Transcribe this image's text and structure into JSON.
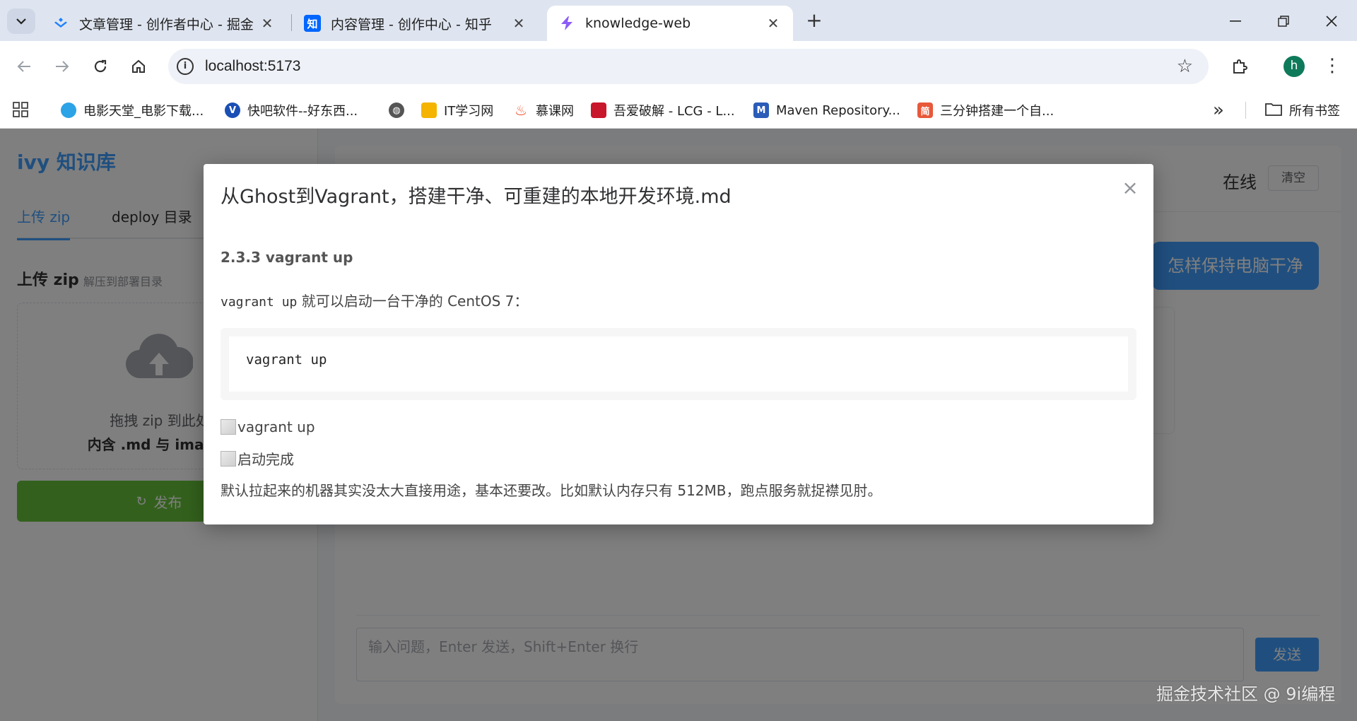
{
  "browser": {
    "tabs": [
      {
        "title": "文章管理 - 创作者中心 - 掘金",
        "favicon": "juejin-icon",
        "active": false
      },
      {
        "title": "内容管理 - 创作中心 - 知乎",
        "favicon": "zhihu-icon",
        "favicon_text": "知",
        "active": false
      },
      {
        "title": "knowledge-web",
        "favicon": "vite-icon",
        "active": true
      }
    ],
    "url": "localhost:5173",
    "profile_initial": "h",
    "bookmarks": [
      {
        "label": "电影天堂_电影下载...",
        "icon": "shield-icon"
      },
      {
        "label": "快吧软件--好东西...",
        "icon": "v-icon"
      },
      {
        "label": "",
        "icon": "globe-icon"
      },
      {
        "label": "IT学习网",
        "icon": "folder-mail-icon"
      },
      {
        "label": "慕课网",
        "icon": "flame-icon"
      },
      {
        "label": "吾爱破解 - LCG - L...",
        "icon": "52pojie-icon"
      },
      {
        "label": "Maven Repository...",
        "icon": "maven-icon",
        "icon_text": "M"
      },
      {
        "label": "三分钟搭建一个自...",
        "icon": "jianshu-icon",
        "icon_text": "简"
      }
    ],
    "all_bookmarks": "所有书签"
  },
  "sidebar": {
    "logo": "ivy 知识库",
    "tabs": [
      "上传 zip",
      "deploy 目录"
    ],
    "upload_title": "上传 zip",
    "upload_sub": "解压到部署目录",
    "drop_line1": "拖拽 zip 到此处",
    "drop_line2": "内含 .md 与 images",
    "publish": "发布"
  },
  "chat": {
    "status": "在线",
    "clear": "清空",
    "user_message": "怎样保持电脑干净",
    "input_placeholder": "输入问题，Enter 发送，Shift+Enter 换行",
    "send": "发送"
  },
  "modal": {
    "title": "从Ghost到Vagrant，搭建干净、可重建的本地开发环境.md",
    "heading": "2.3.3 vagrant up",
    "p1_code": "vagrant up",
    "p1_text": " 就可以启动一台干净的 CentOS 7：",
    "code": "vagrant up",
    "img1_alt": "vagrant up",
    "img2_alt": "启动完成",
    "p2": "默认拉起来的机器其实没太大直接用途，基本还要改。比如默认内存只有 512MB，跑点服务就捉襟见肘。"
  },
  "watermark": "掘金技术社区 @ 9i编程",
  "colors": {
    "primary": "#409eff",
    "success": "#67c23a"
  }
}
